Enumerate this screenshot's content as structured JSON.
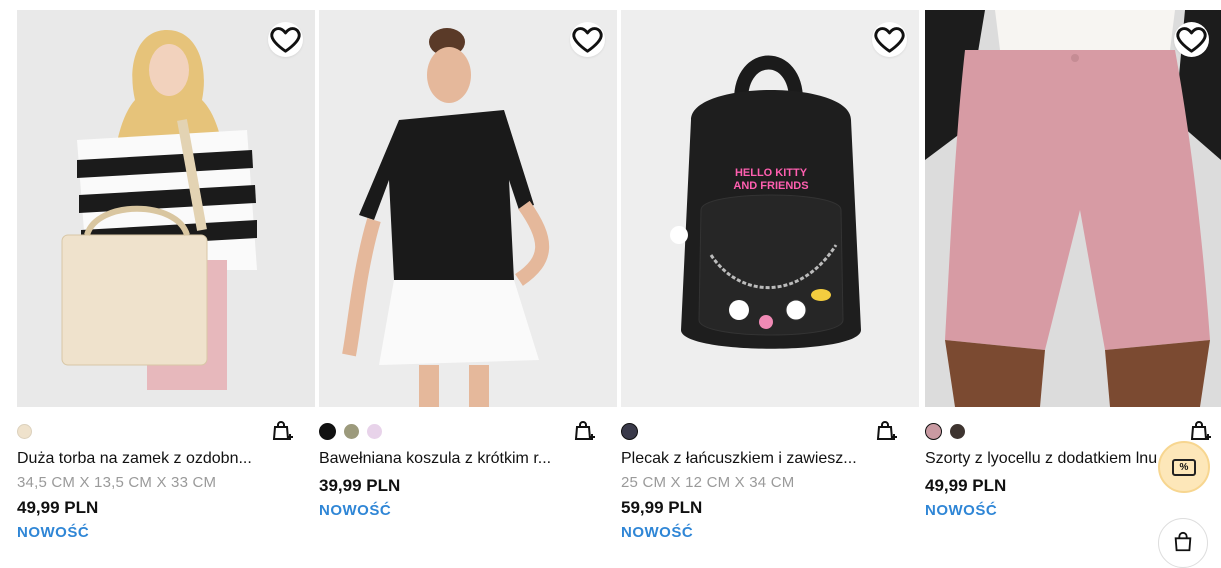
{
  "products": [
    {
      "name": "Duża torba na zamek z ozdobn...",
      "dims": "34,5 CM X 13,5 CM X 33 CM",
      "price": "49,99 PLN",
      "badge": "NOWOŚĆ",
      "swatches": [
        {
          "color": "#efe2cc",
          "selected": false
        }
      ],
      "image": "woman-striped-sweater-tote-bag"
    },
    {
      "name": "Bawełniana koszula z krótkim r...",
      "dims": "",
      "price": "39,99 PLN",
      "badge": "NOWOŚĆ",
      "swatches": [
        {
          "color": "#111111",
          "selected": true
        },
        {
          "color": "#9c9a7c",
          "selected": false
        },
        {
          "color": "#e8d3ea",
          "selected": false
        }
      ],
      "image": "woman-black-shirt-white-skirt"
    },
    {
      "name": "Plecak z łańcuszkiem i zawiesz...",
      "dims": "25 CM X 12 CM X 34 CM",
      "price": "59,99 PLN",
      "badge": "NOWOŚĆ",
      "swatches": [
        {
          "color": "#3a3a4a",
          "selected": true
        }
      ],
      "image": "black-backpack-hello-kitty",
      "print": [
        "HELLO KITTY",
        "AND FRIENDS"
      ]
    },
    {
      "name": "Szorty z lyocellu z dodatkiem lnu",
      "dims": "",
      "price": "49,99 PLN",
      "badge": "NOWOŚĆ",
      "swatches": [
        {
          "color": "#c99aa2",
          "selected": true
        },
        {
          "color": "#3e3430",
          "selected": false
        }
      ],
      "image": "pink-linen-shorts"
    }
  ],
  "promo": {
    "label": "%"
  },
  "colors": {
    "accent": "#2f86d6",
    "promo_bg": "#fde7b9"
  }
}
